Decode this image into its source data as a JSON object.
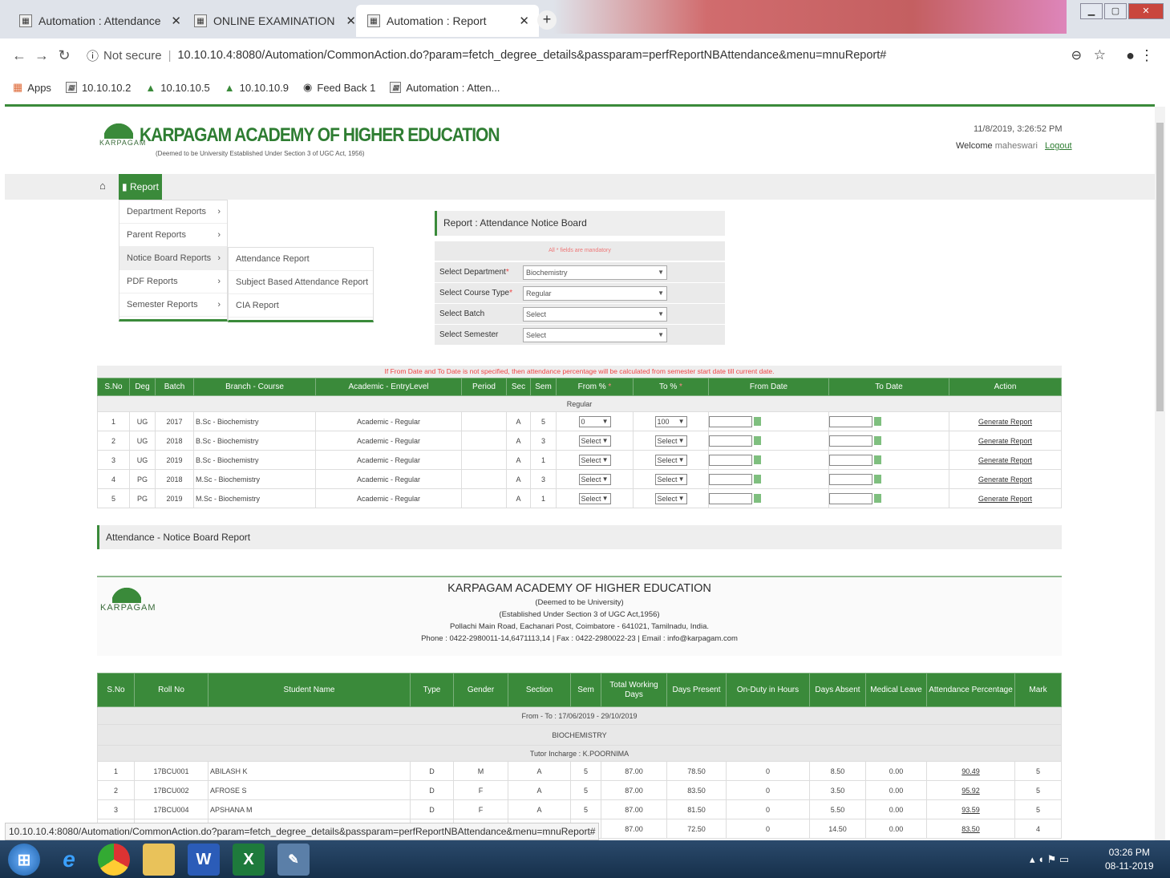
{
  "browser": {
    "tabs": [
      {
        "title": "Automation : Attendance"
      },
      {
        "title": "ONLINE EXAMINATION"
      },
      {
        "title": "Automation : Report"
      }
    ],
    "security": "Not secure",
    "url": "10.10.10.4:8080/Automation/CommonAction.do?param=fetch_degree_details&passparam=perfReportNBAttendance&menu=mnuReport#",
    "bookmarks": [
      "Apps",
      "10.10.10.2",
      "10.10.10.5",
      "10.10.10.9",
      "Feed Back 1",
      "Automation : Atten..."
    ]
  },
  "header": {
    "org_name": "KARPAGAM ACADEMY OF HIGHER EDUCATION",
    "org_sub": "(Deemed to be University Established Under Section 3 of UGC Act, 1956)",
    "logo_text": "KARPAGAM",
    "datetime": "11/8/2019, 3:26:52 PM",
    "welcome": "Welcome",
    "user": "maheswari",
    "logout": "Logout"
  },
  "menu": {
    "report": "Report",
    "items": [
      "Department Reports",
      "Parent Reports",
      "Notice Board Reports",
      "PDF Reports",
      "Semester Reports"
    ],
    "submenu": [
      "Attendance Report",
      "Subject Based Attendance Report",
      "CIA Report"
    ]
  },
  "form": {
    "title": "Report : Attendance Notice Board",
    "mandatory": "All * fields are mandatory",
    "rows": [
      {
        "label": "Select Department",
        "req": "*",
        "value": "Biochemistry"
      },
      {
        "label": "Select Course Type",
        "req": "*",
        "value": "Regular"
      },
      {
        "label": "Select Batch",
        "req": "",
        "value": "Select"
      },
      {
        "label": "Select Semester",
        "req": "",
        "value": "Select"
      }
    ]
  },
  "table1": {
    "note": "If From Date and To Date is not specified, then attendance percentage will be calculated from semester start date till current date.",
    "headers": [
      "S.No",
      "Deg",
      "Batch",
      "Branch - Course",
      "Academic - EntryLevel",
      "Period",
      "Sec",
      "Sem",
      "From %",
      "To %",
      "From Date",
      "To Date",
      "Action"
    ],
    "group": "Regular",
    "rows": [
      {
        "sno": "1",
        "deg": "UG",
        "batch": "2017",
        "branch": "B.Sc - Biochemistry",
        "academic": "Academic - Regular",
        "period": "",
        "sec": "A",
        "sem": "5",
        "from": "0",
        "to": "100",
        "action": "Generate Report"
      },
      {
        "sno": "2",
        "deg": "UG",
        "batch": "2018",
        "branch": "B.Sc - Biochemistry",
        "academic": "Academic - Regular",
        "period": "",
        "sec": "A",
        "sem": "3",
        "from": "Select",
        "to": "Select",
        "action": "Generate Report"
      },
      {
        "sno": "3",
        "deg": "UG",
        "batch": "2019",
        "branch": "B.Sc - Biochemistry",
        "academic": "Academic - Regular",
        "period": "",
        "sec": "A",
        "sem": "1",
        "from": "Select",
        "to": "Select",
        "action": "Generate Report"
      },
      {
        "sno": "4",
        "deg": "PG",
        "batch": "2018",
        "branch": "M.Sc - Biochemistry",
        "academic": "Academic - Regular",
        "period": "",
        "sec": "A",
        "sem": "3",
        "from": "Select",
        "to": "Select",
        "action": "Generate Report"
      },
      {
        "sno": "5",
        "deg": "PG",
        "batch": "2019",
        "branch": "M.Sc - Biochemistry",
        "academic": "Academic - Regular",
        "period": "",
        "sec": "A",
        "sem": "1",
        "from": "Select",
        "to": "Select",
        "action": "Generate Report"
      }
    ]
  },
  "section_title": "Attendance - Notice Board Report",
  "report_header": {
    "name": "KARPAGAM ACADEMY OF HIGHER EDUCATION",
    "line1": "(Deemed to be University)",
    "line2": "(Established Under Section 3 of UGC Act,1956)",
    "line3": "Pollachi Main Road, Eachanari Post, Coimbatore - 641021, Tamilnadu, India.",
    "line4": "Phone : 0422-2980011-14,6471113,14 | Fax : 0422-2980022-23 | Email : info@karpagam.com"
  },
  "table2": {
    "headers": [
      "S.No",
      "Roll No",
      "Student Name",
      "Type",
      "Gender",
      "Section",
      "Sem",
      "Total Working Days",
      "Days Present",
      "On-Duty in Hours",
      "Days Absent",
      "Medical Leave",
      "Attendance Percentage",
      "Mark"
    ],
    "fromto": "From - To : 17/06/2019 - 29/10/2019",
    "dept": "BIOCHEMISTRY",
    "tutor": "Tutor Incharge : K.POORNIMA",
    "rows": [
      {
        "sno": "1",
        "roll": "17BCU001",
        "name": "ABILASH K",
        "type": "D",
        "gender": "M",
        "section": "A",
        "sem": "5",
        "twd": "87.00",
        "present": "78.50",
        "od": "0",
        "absent": "8.50",
        "ml": "0.00",
        "pct": "90.49",
        "mark": "5"
      },
      {
        "sno": "2",
        "roll": "17BCU002",
        "name": "AFROSE S",
        "type": "D",
        "gender": "F",
        "section": "A",
        "sem": "5",
        "twd": "87.00",
        "present": "83.50",
        "od": "0",
        "absent": "3.50",
        "ml": "0.00",
        "pct": "95.92",
        "mark": "5"
      },
      {
        "sno": "3",
        "roll": "17BCU004",
        "name": "APSHANA M",
        "type": "D",
        "gender": "F",
        "section": "A",
        "sem": "5",
        "twd": "87.00",
        "present": "81.50",
        "od": "0",
        "absent": "5.50",
        "ml": "0.00",
        "pct": "93.59",
        "mark": "5"
      },
      {
        "sno": "",
        "roll": "",
        "name": "",
        "type": "",
        "gender": "",
        "section": "",
        "sem": "5",
        "twd": "87.00",
        "present": "72.50",
        "od": "0",
        "absent": "14.50",
        "ml": "0.00",
        "pct": "83.50",
        "mark": "4"
      }
    ]
  },
  "status_url": "10.10.10.4:8080/Automation/CommonAction.do?param=fetch_degree_details&passparam=perfReportNBAttendance&menu=mnuReport#",
  "taskbar": {
    "time": "03:26 PM",
    "date": "08-11-2019"
  }
}
